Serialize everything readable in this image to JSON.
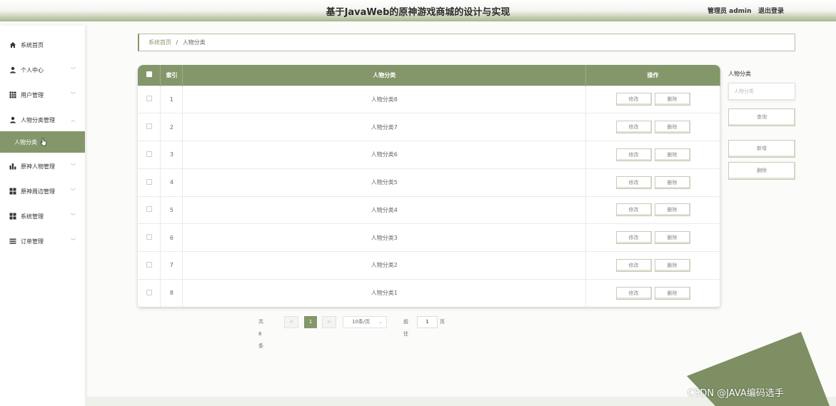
{
  "header": {
    "title": "基于JavaWeb的原神游戏商城的设计与实现",
    "user": "管理员 admin",
    "logout": "退出登录"
  },
  "sidebar": {
    "items": [
      {
        "label": "系统首页",
        "icon": "home-icon",
        "chevron": false
      },
      {
        "label": "个人中心",
        "icon": "user-icon",
        "chevron": "down"
      },
      {
        "label": "用户管理",
        "icon": "grid-icon",
        "chevron": "down"
      },
      {
        "label": "人物分类管理",
        "icon": "user-icon",
        "chevron": "up"
      },
      {
        "label": "人物分类",
        "icon": "",
        "chevron": false,
        "active": true
      },
      {
        "label": "原神人物管理",
        "icon": "bar-chart-icon",
        "chevron": "down"
      },
      {
        "label": "原神周边管理",
        "icon": "apps-icon",
        "chevron": "down"
      },
      {
        "label": "系统管理",
        "icon": "apps-icon",
        "chevron": "down"
      },
      {
        "label": "订单管理",
        "icon": "list-icon",
        "chevron": "down"
      }
    ]
  },
  "breadcrumb": {
    "home": "系统首页",
    "separator": "/",
    "current": "人物分类"
  },
  "table": {
    "headers": {
      "index": "索引",
      "name": "人物分类",
      "ops": "操作"
    },
    "edit_label": "修改",
    "delete_label": "删除",
    "rows": [
      {
        "index": "1",
        "name": "人物分类8"
      },
      {
        "index": "2",
        "name": "人物分类7"
      },
      {
        "index": "3",
        "name": "人物分类6"
      },
      {
        "index": "4",
        "name": "人物分类5"
      },
      {
        "index": "5",
        "name": "人物分类4"
      },
      {
        "index": "6",
        "name": "人物分类3"
      },
      {
        "index": "7",
        "name": "人物分类2"
      },
      {
        "index": "8",
        "name": "人物分类1"
      }
    ]
  },
  "pagination": {
    "total": "共 8 条",
    "prev": "<",
    "current_page": "1",
    "next": ">",
    "page_size": "10条/页",
    "goto_label": "前往",
    "goto_value": "1",
    "page_suffix": "页"
  },
  "filter": {
    "label": "人物分类",
    "placeholder": "人物分类",
    "search_label": "查询",
    "add_label": "新增",
    "delete_label": "删除"
  },
  "watermark": "CSDN @JAVA编码选手",
  "colors": {
    "accent": "#84976a",
    "accent_dark": "#7d8f63"
  }
}
